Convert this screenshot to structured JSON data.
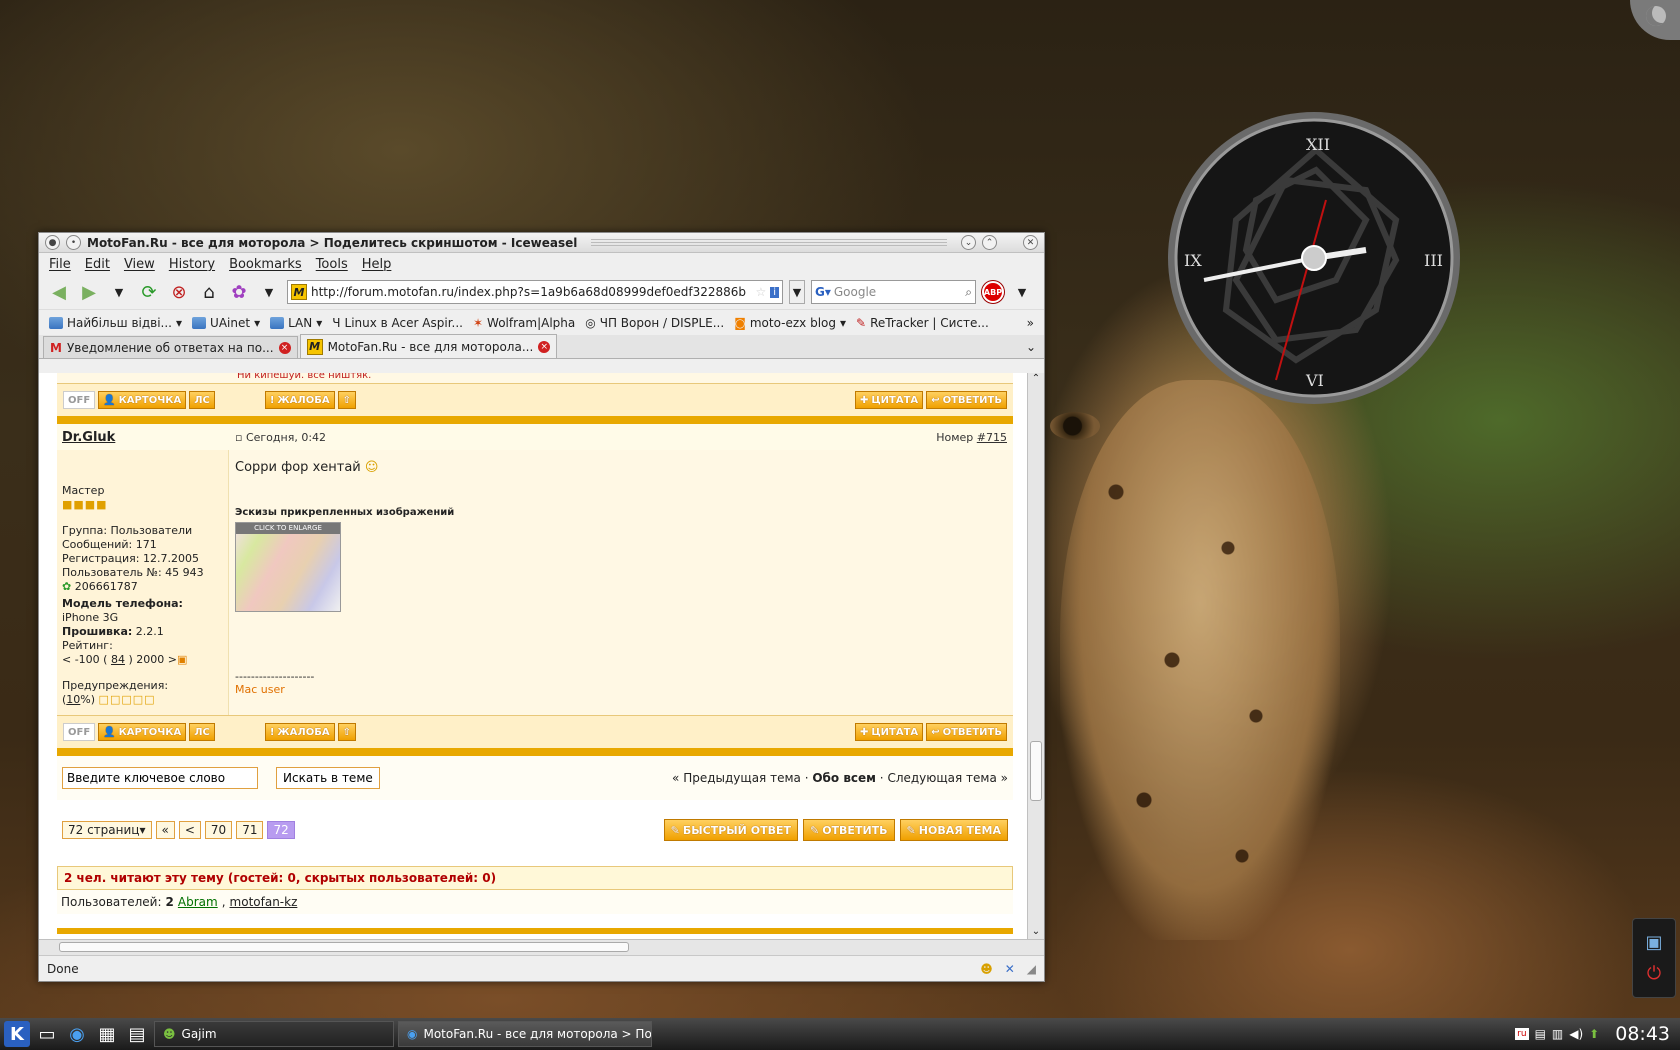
{
  "window": {
    "title": "MotoFan.Ru - все для моторола > Поделитесь скриншотом - Iceweasel",
    "menu": [
      "File",
      "Edit",
      "View",
      "History",
      "Bookmarks",
      "Tools",
      "Help"
    ],
    "url": "http://forum.motofan.ru/index.php?s=1a9b6a68d08999def0edf322886b",
    "search_placeholder": "Google",
    "bookmarks": [
      "Найбільш відві...",
      "UAinet",
      "LAN",
      "Linux в Acer Aspir...",
      "Wolfram|Alpha",
      "ЧП Ворон / DISPLE...",
      "moto-ezx blog",
      "ReTracker | Систе..."
    ],
    "tabs": [
      "Уведомление об ответах на по...",
      "MotoFan.Ru - все для моторола..."
    ],
    "status": "Done"
  },
  "post_prev": {
    "cut_text": "Ни кипешуй. все ништяк."
  },
  "buttons": {
    "off": "OFF",
    "card": "КАРТОЧКА",
    "pm": "ЛС",
    "report": "ЖАЛОБА",
    "quote": "ЦИТАТА",
    "reply": "ОТВЕТИТЬ"
  },
  "post": {
    "author": "Dr.Gluk",
    "date": "Сегодня, 0:42",
    "number_label": "Номер",
    "number": "#715",
    "text": "Сорри фор хентай",
    "attach_title": "Эскизы прикрепленных изображений",
    "click_to_enlarge": "CLICK TO ENLARGE",
    "signature_line": "--------------------",
    "signature": "Mac user",
    "rank": "Мастер",
    "group": "Группа: Пользователи",
    "messages": "Сообщений: 171",
    "registered": "Регистрация: 12.7.2005",
    "user_no": "Пользователь №: 45 943",
    "icq": "206661787",
    "phone_label": "Модель телефона:",
    "phone": "iPhone 3G",
    "firmware_label": "Прошивка:",
    "firmware": "2.2.1",
    "rating_label": "Рейтинг:",
    "rating_lo": "< -100 (",
    "rating_val": "84",
    "rating_hi": ") 2000 >",
    "warn_label": "Предупреждения:",
    "warn_open": "(",
    "warn_val": "10",
    "warn_close": "%)"
  },
  "search": {
    "placeholder_value": "Введите ключевое слово",
    "button": "Искать в теме"
  },
  "nav": {
    "prev": "« Предыдущая тема",
    "sep": " · ",
    "all": "Обо всем",
    "next": "Следующая тема »"
  },
  "pager": {
    "pages": "72 страниц",
    "first": "«",
    "prev": "<",
    "p1": "70",
    "p2": "71",
    "cur": "72"
  },
  "bigbuttons": {
    "fast": "БЫСТРЫЙ ОТВЕТ",
    "reply": "ОТВЕТИТЬ",
    "new": "НОВАЯ ТЕМА"
  },
  "readers": "2 чел. читают эту тему (гостей: 0, скрытых пользователей: 0)",
  "users": {
    "label": "Пользователей:",
    "count": "2",
    "u1": "Abram",
    "u2": "motofan-kz"
  },
  "taskbar": {
    "task1": "Gajim",
    "task2": "MotoFan.Ru - все для моторола > По",
    "time": "08:43",
    "lang": "ru"
  },
  "clock": {
    "xii": "XII",
    "iii": "III",
    "vi": "VI",
    "ix": "IX"
  }
}
